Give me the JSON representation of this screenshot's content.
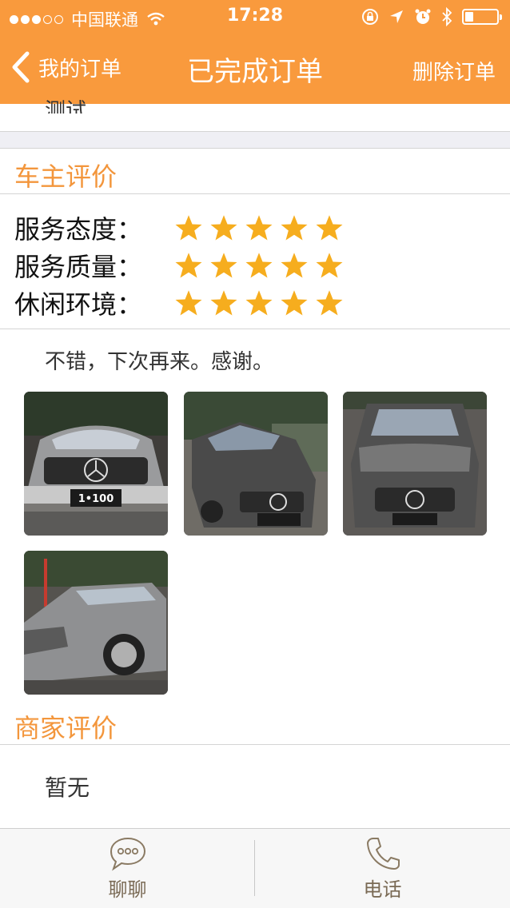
{
  "status_bar": {
    "carrier": "中国联通",
    "time": "17:28",
    "signal_dots_filled": 3,
    "signal_dots_total": 5
  },
  "nav": {
    "back_label": "我的订单",
    "title": "已完成订单",
    "right_action": "删除订单"
  },
  "previous_section_tail": "测试",
  "owner_review": {
    "title": "车主评价",
    "ratings": [
      {
        "label": "服务态度：",
        "stars": 5
      },
      {
        "label": "服务质量：",
        "stars": 5
      },
      {
        "label": "休闲环境：",
        "stars": 5
      }
    ],
    "comment": "不错，下次再来。感谢。",
    "photos": [
      "car-photo-1",
      "car-photo-2",
      "car-photo-3",
      "car-photo-4"
    ],
    "plate_text": "1•100"
  },
  "merchant_review": {
    "title": "商家评价",
    "content": "暂无"
  },
  "bottom_bar": {
    "chat_label": "聊聊",
    "phone_label": "电话"
  },
  "colors": {
    "accent": "#f99a3d",
    "section_title": "#f3963c",
    "star": "#f6ad1e"
  }
}
